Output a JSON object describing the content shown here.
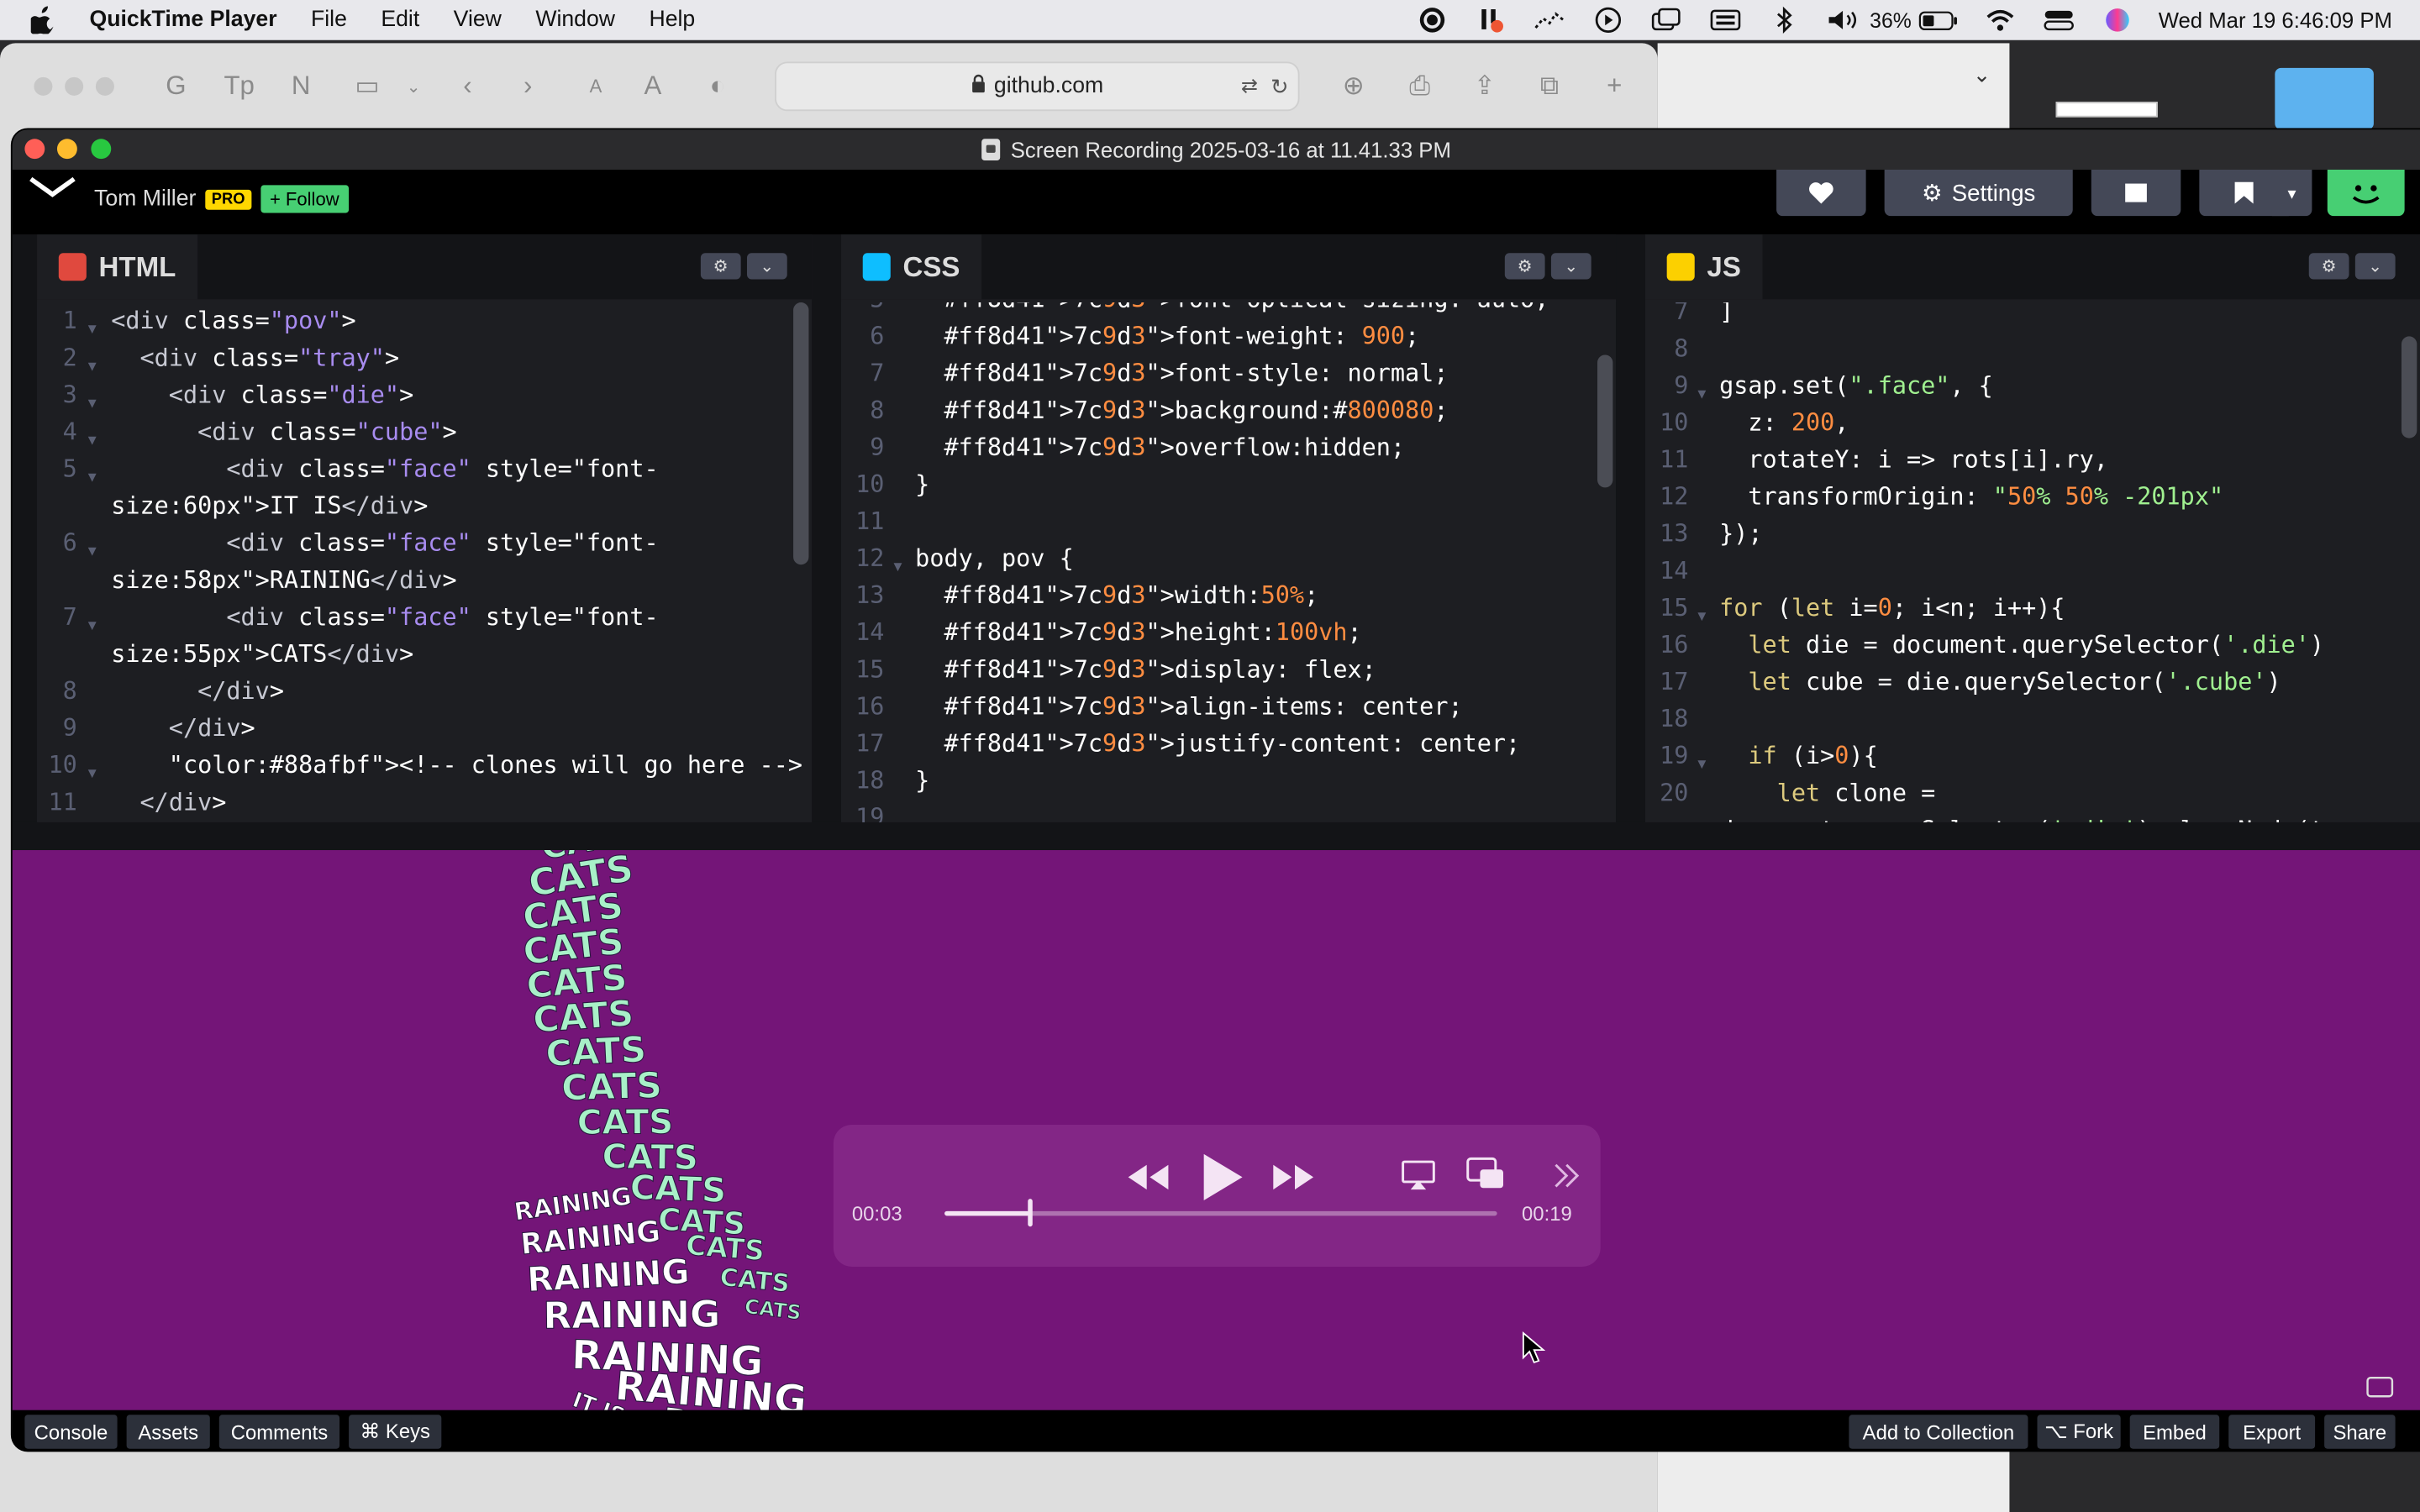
{
  "menubar": {
    "app": "QuickTime Player",
    "menus": [
      "File",
      "Edit",
      "View",
      "Window",
      "Help"
    ],
    "battery": "36%",
    "clock": "Wed Mar 19  6:46:09 PM"
  },
  "safari": {
    "url": "github.com"
  },
  "quicktime": {
    "title": "Screen Recording 2025-03-16 at 11.41.33 PM",
    "current_time": "00:03",
    "duration": "00:19",
    "progress": 0.155
  },
  "codepen": {
    "author": "Tom Miller",
    "pro": "PRO",
    "follow": "+ Follow",
    "settings": "Settings",
    "panes": {
      "html": "HTML",
      "css": "CSS",
      "js": "JS"
    },
    "html_lines": [
      {
        "n": "1",
        "t": "<div class=\"pov\">"
      },
      {
        "n": "2",
        "t": "  <div class=\"tray\">"
      },
      {
        "n": "3",
        "t": "    <div class=\"die\">"
      },
      {
        "n": "4",
        "t": "      <div class=\"cube\">"
      },
      {
        "n": "5",
        "t": "        <div class=\"face\" style=\"font-"
      },
      {
        "n": "",
        "t": "size:60px\">IT IS</div>"
      },
      {
        "n": "6",
        "t": "        <div class=\"face\" style=\"font-"
      },
      {
        "n": "",
        "t": "size:58px\">RAINING</div>"
      },
      {
        "n": "7",
        "t": "        <div class=\"face\" style=\"font-"
      },
      {
        "n": "",
        "t": "size:55px\">CATS</div>"
      },
      {
        "n": "8",
        "t": "      </div>"
      },
      {
        "n": "9",
        "t": "    </div>"
      },
      {
        "n": "10",
        "t": "    <!-- clones will go here -->"
      },
      {
        "n": "11",
        "t": "  </div>"
      }
    ],
    "css_lines": [
      {
        "n": "5",
        "t": "  font-optical-sizing: auto;"
      },
      {
        "n": "6",
        "t": "  font-weight: 900;"
      },
      {
        "n": "7",
        "t": "  font-style: normal;"
      },
      {
        "n": "8",
        "t": "  background:#800080;"
      },
      {
        "n": "9",
        "t": "  overflow:hidden;"
      },
      {
        "n": "10",
        "t": "}"
      },
      {
        "n": "11",
        "t": ""
      },
      {
        "n": "12",
        "t": "body, pov {"
      },
      {
        "n": "13",
        "t": "  width:50%;"
      },
      {
        "n": "14",
        "t": "  height:100vh;"
      },
      {
        "n": "15",
        "t": "  display: flex;"
      },
      {
        "n": "16",
        "t": "  align-items: center;"
      },
      {
        "n": "17",
        "t": "  justify-content: center;"
      },
      {
        "n": "18",
        "t": "}"
      },
      {
        "n": "19",
        "t": ""
      }
    ],
    "js_lines": [
      {
        "n": "7",
        "t": "]"
      },
      {
        "n": "8",
        "t": ""
      },
      {
        "n": "9",
        "t": "gsap.set(\".face\", {"
      },
      {
        "n": "10",
        "t": "  z: 200,"
      },
      {
        "n": "11",
        "t": "  rotateY: i => rots[i].ry,"
      },
      {
        "n": "12",
        "t": "  transformOrigin: \"50% 50% -201px\""
      },
      {
        "n": "13",
        "t": "});"
      },
      {
        "n": "14",
        "t": ""
      },
      {
        "n": "15",
        "t": "for (let i=0; i<n; i++){"
      },
      {
        "n": "16",
        "t": "  let die = document.querySelector('.die')"
      },
      {
        "n": "17",
        "t": "  let cube = die.querySelector('.cube')"
      },
      {
        "n": "18",
        "t": ""
      },
      {
        "n": "19",
        "t": "  if (i>0){"
      },
      {
        "n": "20",
        "t": "    let clone ="
      },
      {
        "n": "",
        "t": "document.querySelector('.die').cloneNode(t"
      }
    ],
    "result": {
      "word_cats": "CATS",
      "word_raining": "RAINING",
      "word_itis": "IT IS"
    },
    "footer_left": [
      "Console",
      "Assets",
      "Comments",
      "⌘ Keys"
    ],
    "footer_right": [
      "Add to Collection",
      "⌥ Fork",
      "Embed",
      "Export",
      "Share"
    ]
  },
  "colors": {
    "result_bg": "#741578",
    "cats": "#a8f0c8",
    "raining": "#ffffff",
    "editor_bg": "#1d1e22"
  }
}
